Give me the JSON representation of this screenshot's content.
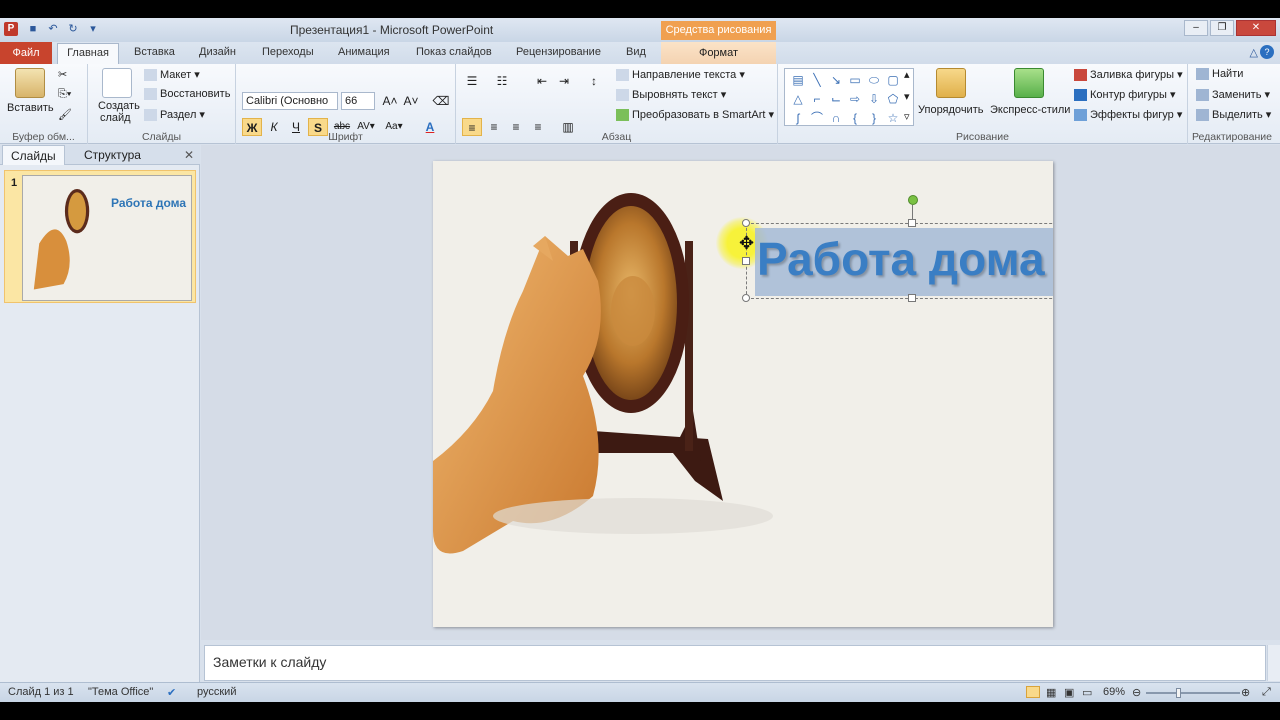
{
  "window": {
    "title": "Презентация1 - Microsoft PowerPoint",
    "contextual_tab_group": "Средства рисования"
  },
  "tabs": [
    "Файл",
    "Главная",
    "Вставка",
    "Дизайн",
    "Переходы",
    "Анимация",
    "Показ слайдов",
    "Рецензирование",
    "Вид",
    "Формат"
  ],
  "ribbon": {
    "clipboard": {
      "paste": "Вставить",
      "label": "Буфер обм..."
    },
    "slides": {
      "new_slide_1": "Создать",
      "new_slide_2": "слайд",
      "layout": "Макет",
      "reset": "Восстановить",
      "section": "Раздел",
      "label": "Слайды"
    },
    "font": {
      "font_name": "Calibri (Основно",
      "font_size": "66",
      "bold": "Ж",
      "italic": "К",
      "underline": "Ч",
      "shadow": "S",
      "strike": "abc",
      "label": "Шрифт"
    },
    "paragraph": {
      "text_direction": "Направление текста",
      "align_text": "Выровнять текст",
      "smartart": "Преобразовать в SmartArt",
      "label": "Абзац"
    },
    "drawing": {
      "arrange": "Упорядочить",
      "quick_styles": "Экспресс-стили",
      "shape_fill": "Заливка фигуры",
      "shape_outline": "Контур фигуры",
      "shape_effects": "Эффекты фигур",
      "label": "Рисование"
    },
    "editing": {
      "find": "Найти",
      "replace": "Заменить",
      "select": "Выделить",
      "label": "Редактирование"
    }
  },
  "left_pane": {
    "tab_slides": "Слайды",
    "tab_outline": "Структура",
    "slide_number": "1",
    "thumb_title": "Работа дома"
  },
  "slide": {
    "title": "Работа дома"
  },
  "notes": {
    "placeholder": "Заметки к слайду"
  },
  "status": {
    "slide_info": "Слайд 1 из 1",
    "theme": "\"Тема Office\"",
    "language": "русский",
    "zoom": "69%"
  },
  "icons": [
    "powerpoint-logo-icon",
    "save-icon",
    "undo-icon",
    "redo-icon",
    "paste-icon",
    "new-slide-icon",
    "mirror-cat-lion-image",
    "help-icon",
    "close-icon"
  ]
}
